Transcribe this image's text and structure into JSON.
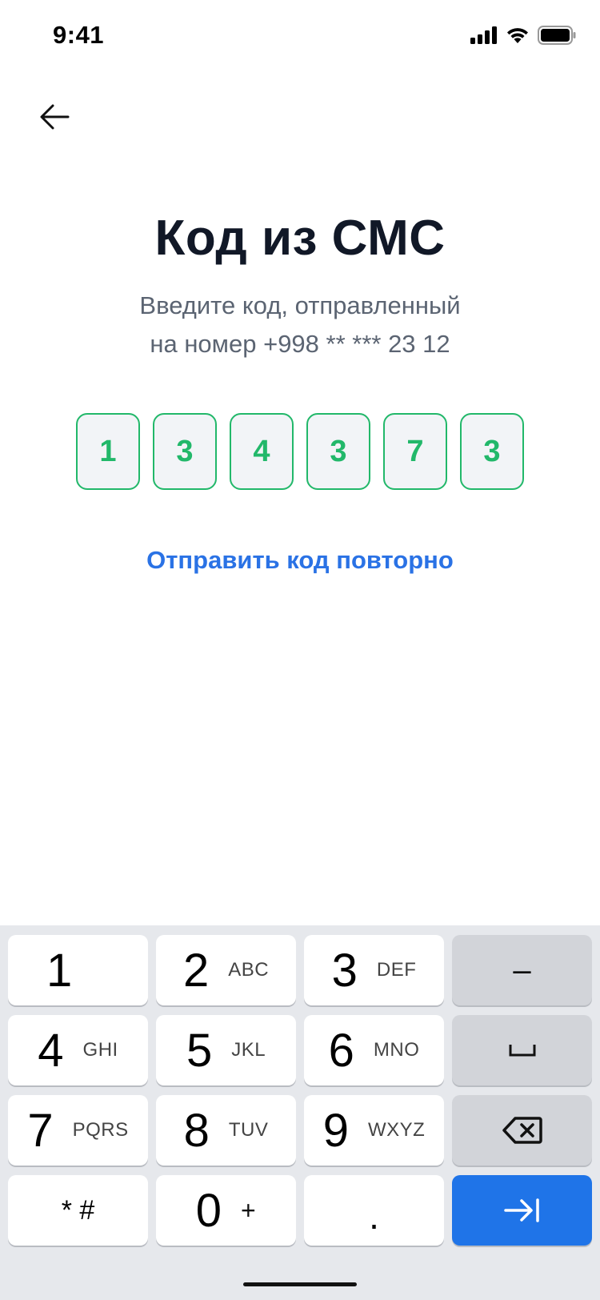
{
  "status_bar": {
    "time": "9:41"
  },
  "header": {
    "title": "Код из СМС"
  },
  "subtitle": {
    "line1": "Введите код, отправленный",
    "line2": "на номер +998 ** *** 23 12"
  },
  "otp": {
    "digits": [
      "1",
      "3",
      "4",
      "3",
      "7",
      "3"
    ]
  },
  "resend": {
    "label": "Отправить код повторно"
  },
  "keyboard": {
    "keys": [
      {
        "digit": "1",
        "letters": ""
      },
      {
        "digit": "2",
        "letters": "ABC"
      },
      {
        "digit": "3",
        "letters": "DEF"
      },
      {
        "digit": "4",
        "letters": "GHI"
      },
      {
        "digit": "5",
        "letters": "JKL"
      },
      {
        "digit": "6",
        "letters": "MNO"
      },
      {
        "digit": "7",
        "letters": "PQRS"
      },
      {
        "digit": "8",
        "letters": "TUV"
      },
      {
        "digit": "9",
        "letters": "WXYZ"
      },
      {
        "digit": "0",
        "letters": "+"
      }
    ],
    "symbols_label": "* #",
    "dot_label": ".",
    "dash_label": "–"
  },
  "colors": {
    "accent_green": "#22b86a",
    "link_blue": "#2a72e5",
    "key_blue": "#1f74e8",
    "title": "#111827",
    "subtitle": "#5b6472"
  }
}
